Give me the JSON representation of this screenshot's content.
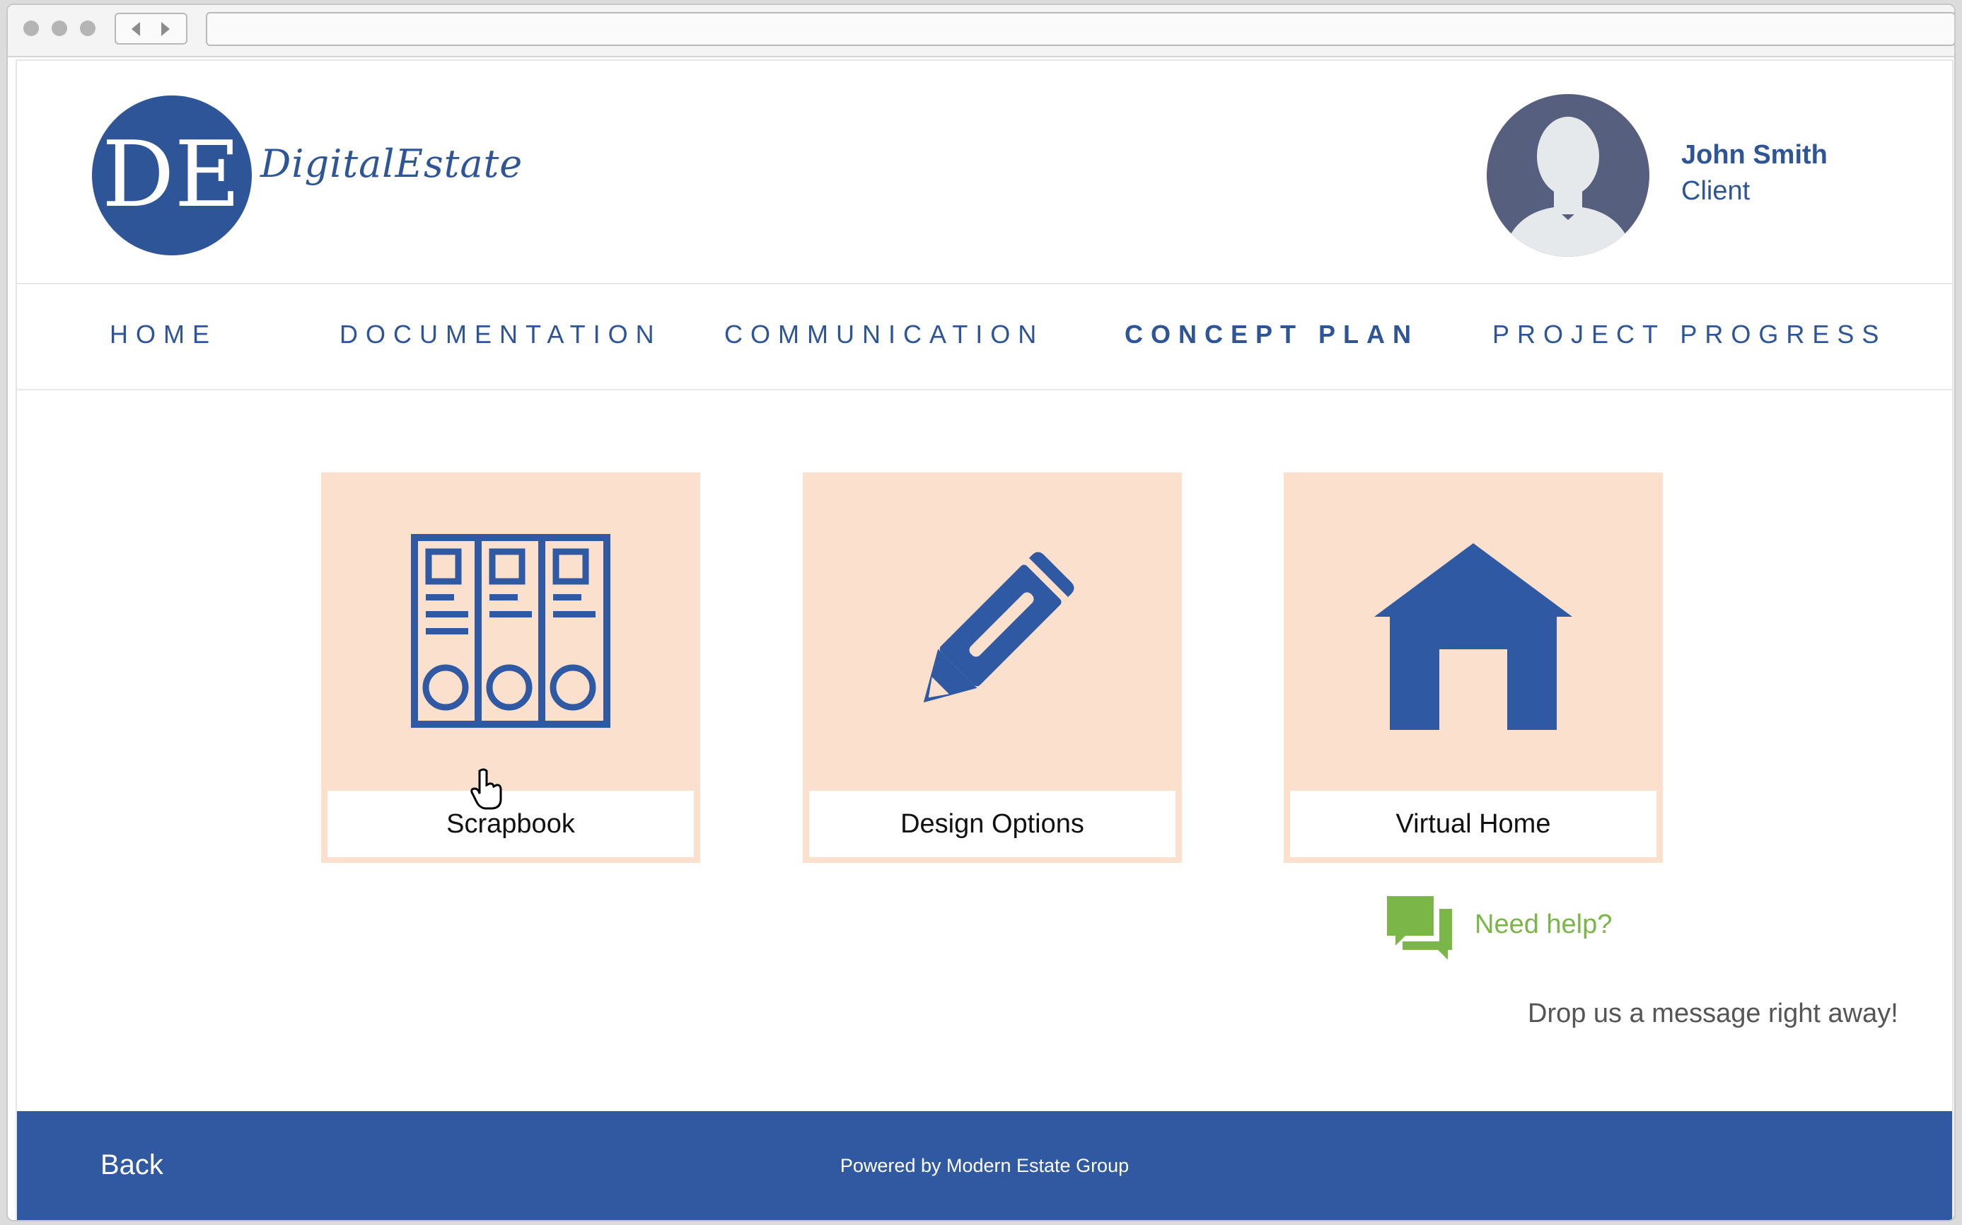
{
  "brand": {
    "monogram": "DE",
    "name": "DigitalEstate",
    "primary_color": "#2e5597"
  },
  "user": {
    "name": "John Smith",
    "role": "Client"
  },
  "nav": {
    "items": [
      {
        "label": "HOME",
        "active": false
      },
      {
        "label": "DOCUMENTATION",
        "active": false
      },
      {
        "label": "COMMUNICATION",
        "active": false
      },
      {
        "label": "CONCEPT PLAN",
        "active": true
      },
      {
        "label": "PROJECT PROGRESS",
        "active": false
      }
    ]
  },
  "cards": [
    {
      "label": "Scrapbook",
      "icon": "binders-icon"
    },
    {
      "label": "Design Options",
      "icon": "pencil-icon"
    },
    {
      "label": "Virtual Home",
      "icon": "house-icon"
    }
  ],
  "help": {
    "link_label": "Need help?",
    "message": "Drop us a message right away!",
    "icon": "chat-bubbles-icon",
    "color": "#7ab648"
  },
  "footer": {
    "back_label": "Back",
    "powered_by": "Powered by Modern Estate Group",
    "background": "#3059a1"
  },
  "colors": {
    "card_background": "#fbe1cd",
    "icon_blue": "#2f5aa3"
  }
}
